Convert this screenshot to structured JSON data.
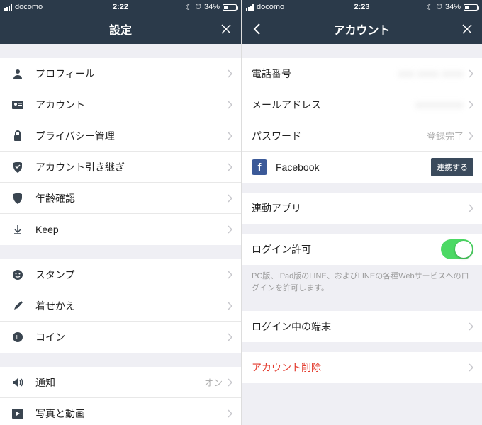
{
  "left": {
    "status": {
      "carrier": "docomo",
      "time": "2:22",
      "battery_pct": "34%"
    },
    "nav": {
      "title": "設定"
    },
    "group1": [
      {
        "icon": "person",
        "label": "プロフィール"
      },
      {
        "icon": "id-card",
        "label": "アカウント"
      },
      {
        "icon": "lock",
        "label": "プライバシー管理"
      },
      {
        "icon": "shield",
        "label": "アカウント引き継ぎ"
      },
      {
        "icon": "badge",
        "label": "年齢確認"
      },
      {
        "icon": "keep",
        "label": "Keep"
      }
    ],
    "group2": [
      {
        "icon": "smile",
        "label": "スタンプ"
      },
      {
        "icon": "brush",
        "label": "着せかえ"
      },
      {
        "icon": "coin",
        "label": "コイン"
      }
    ],
    "group3": [
      {
        "icon": "speaker",
        "label": "通知",
        "value": "オン"
      },
      {
        "icon": "media",
        "label": "写真と動画"
      }
    ]
  },
  "right": {
    "status": {
      "carrier": "docomo",
      "time": "2:23",
      "battery_pct": "34%"
    },
    "nav": {
      "title": "アカウント"
    },
    "basic": {
      "phone_label": "電話番号",
      "phone_value": "xxx xxxx xxxx",
      "email_label": "メールアドレス",
      "email_value": "xxxxxxxxx",
      "password_label": "パスワード",
      "password_value": "登録完了",
      "facebook_label": "Facebook",
      "facebook_button": "連携する"
    },
    "linked_apps_label": "連動アプリ",
    "login_allow_label": "ログイン許可",
    "login_allow_note": "PC版、iPad版のLINE、およびLINEの各種Webサービスへのログインを許可します。",
    "logged_in_devices_label": "ログイン中の端末",
    "delete_account_label": "アカウント削除"
  }
}
